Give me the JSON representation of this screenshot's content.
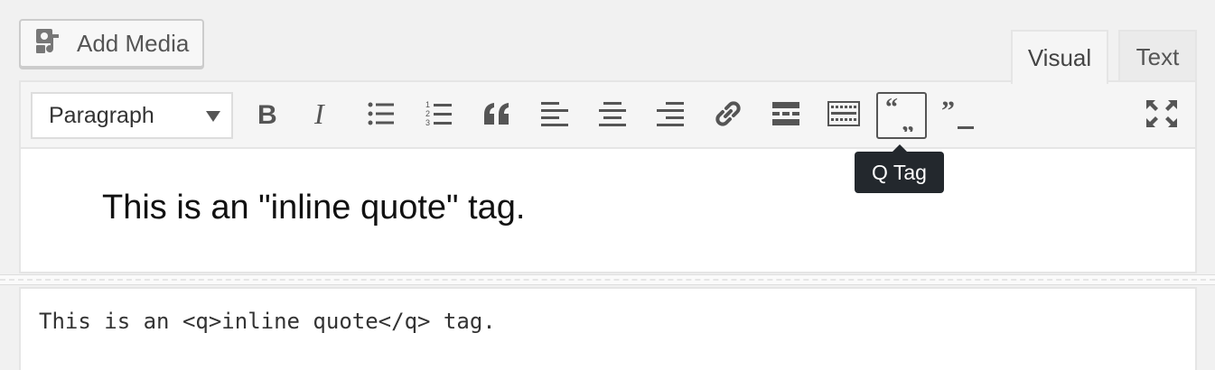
{
  "toolbar": {
    "add_media_label": "Add Media",
    "format_value": "Paragraph",
    "buttons": [
      {
        "name": "bold",
        "icon": "bold-icon"
      },
      {
        "name": "italic",
        "icon": "italic-icon"
      },
      {
        "name": "bulleted-list",
        "icon": "bulleted-list-icon"
      },
      {
        "name": "numbered-list",
        "icon": "numbered-list-icon"
      },
      {
        "name": "blockquote",
        "icon": "blockquote-icon"
      },
      {
        "name": "align-left",
        "icon": "align-left-icon"
      },
      {
        "name": "align-center",
        "icon": "align-center-icon"
      },
      {
        "name": "align-right",
        "icon": "align-right-icon"
      },
      {
        "name": "insert-link",
        "icon": "link-icon"
      },
      {
        "name": "read-more",
        "icon": "read-more-icon"
      },
      {
        "name": "toolbar-toggle",
        "icon": "keyboard-icon"
      },
      {
        "name": "q-tag",
        "icon": "q-tag-icon",
        "active": true
      },
      {
        "name": "cite",
        "icon": "cite-icon"
      },
      {
        "name": "fullscreen",
        "icon": "fullscreen-icon"
      }
    ],
    "numbered_list_digits": [
      "1",
      "2",
      "3"
    ]
  },
  "tabs": {
    "visual": "Visual",
    "text": "Text"
  },
  "tooltip": "Q Tag",
  "editor": {
    "content": "This is an \"inline quote\" tag."
  },
  "code": {
    "content": "This is an <q>inline quote</q> tag."
  },
  "colors": {
    "tooltip_bg": "#23282d",
    "toolbar_bg": "#f5f5f5",
    "icon": "#555555"
  }
}
